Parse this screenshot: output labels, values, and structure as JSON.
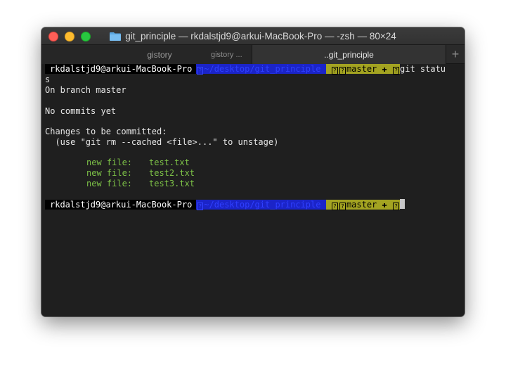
{
  "window": {
    "title": "git_principle — rkdalstjd9@arkui-MacBook-Pro — -zsh — 80×24"
  },
  "tabs": [
    {
      "label": "gistory",
      "sub_label": "gistory ..."
    },
    {
      "label": "..git_principle",
      "active": true
    }
  ],
  "add_tab_label": "+",
  "prompt": {
    "user_host": "rkdalstjd9@arkui-MacBook-Pro",
    "path": "~/desktop/git_principle",
    "branch": "master",
    "dirty_symbol": "✚"
  },
  "terminal": {
    "command": "git statu",
    "command_wrap": "s",
    "lines": [
      "On branch master",
      "",
      "No commits yet",
      "",
      "Changes to be committed:",
      "  (use \"git rm --cached <file>...\" to unstage)"
    ],
    "staged_files": [
      {
        "status": "new file:",
        "name": "test.txt"
      },
      {
        "status": "new file:",
        "name": "test2.txt"
      },
      {
        "status": "new file:",
        "name": "test3.txt"
      }
    ]
  },
  "colors": {
    "path_bg": "#1b24c8",
    "branch_bg": "#a3a321",
    "staged_text": "#7dc247"
  },
  "icons": [
    "folder-icon",
    "close-light-icon",
    "minimize-light-icon",
    "zoom-light-icon",
    "plus-icon"
  ]
}
